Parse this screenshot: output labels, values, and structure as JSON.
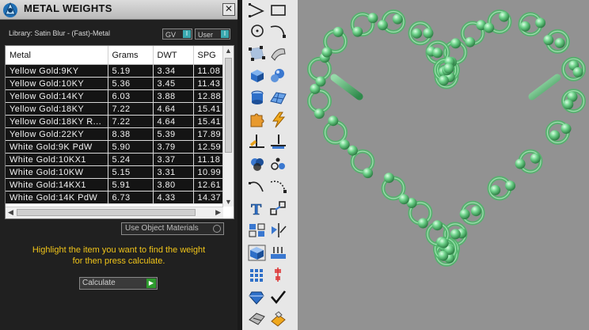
{
  "panel": {
    "title": "METAL WEIGHTS",
    "close_glyph": "✕",
    "library_label": "Library: Satin Blur - (Fast)-Metal",
    "gv_toggle": "GV",
    "user_toggle": "User",
    "columns": [
      "Metal",
      "Grams",
      "DWT",
      "SPG"
    ],
    "rows": [
      [
        "Yellow Gold:9KY",
        "5.19",
        "3.34",
        "11.08"
      ],
      [
        "Yellow Gold:10KY",
        "5.36",
        "3.45",
        "11.43"
      ],
      [
        "Yellow Gold:14KY",
        "6.03",
        "3.88",
        "12.88"
      ],
      [
        "Yellow Gold:18KY",
        "7.22",
        "4.64",
        "15.41"
      ],
      [
        "Yellow Gold:18KY R...",
        "7.22",
        "4.64",
        "15.41"
      ],
      [
        "Yellow Gold:22KY",
        "8.38",
        "5.39",
        "17.89"
      ],
      [
        "White Gold:9K PdW",
        "5.90",
        "3.79",
        "12.59"
      ],
      [
        "White Gold:10KX1",
        "5.24",
        "3.37",
        "11.18"
      ],
      [
        "White Gold:10KW",
        "5.15",
        "3.31",
        "10.99"
      ],
      [
        "White Gold:14KX1",
        "5.91",
        "3.80",
        "12.61"
      ],
      [
        "White Gold:14K PdW",
        "6.73",
        "4.33",
        "14.37"
      ]
    ],
    "use_object_materials": "Use Object Materials",
    "hint_line1": "Highlight the item you want to find the weight",
    "hint_line2": "for then press calculate.",
    "calculate_option": "Calculate"
  },
  "toolbar": {
    "tools": [
      "polyline-icon",
      "rectangle-icon",
      "circle-icon",
      "curve-icon",
      "surface-points-icon",
      "sweep-surface-icon",
      "box-icon",
      "sphere-icon",
      "cylinder-icon",
      "mesh-surface-icon",
      "puzzle-icon",
      "lightning-icon",
      "trim-icon",
      "split-icon",
      "boolean-icon",
      "array-icon",
      "arc-icon",
      "dashed-arc-icon",
      "text-icon",
      "scale-icon",
      "group-icon",
      "mirror-icon",
      "solid-edit-icon",
      "measure-icon",
      "grid-array-icon",
      "align-icon",
      "gem-icon",
      "checkmark-icon",
      "cut-icon",
      "paint-icon"
    ]
  },
  "colors": {
    "hint": "#f0c419",
    "panel_bg": "#202020",
    "viewport_bg": "#929292",
    "bead_green": "#5fc87c"
  }
}
